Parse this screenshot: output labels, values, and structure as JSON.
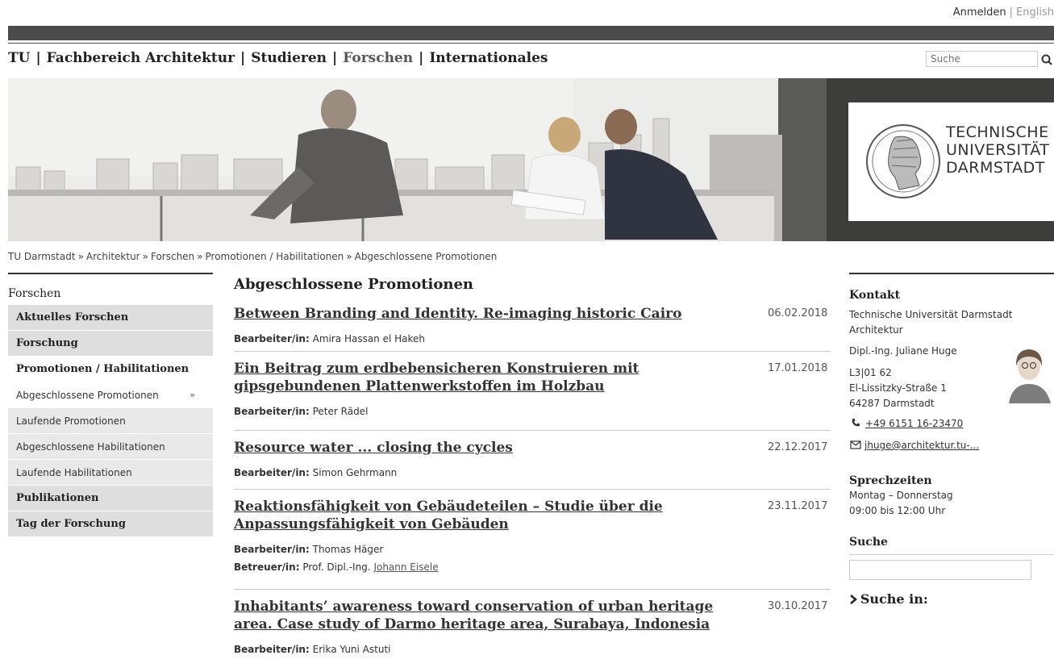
{
  "topmeta": {
    "login": "Anmelden",
    "separator": "|",
    "language": "English"
  },
  "mainnav": {
    "items": [
      "TU",
      "Fachbereich Architektur",
      "Studieren",
      "Forschen",
      "Internationales"
    ],
    "separator": "|"
  },
  "search": {
    "placeholder": "Suche"
  },
  "logo": {
    "line1": "TECHNISCHE",
    "line2": "UNIVERSITÄT",
    "line3": "DARMSTADT"
  },
  "breadcrumb": {
    "items": [
      "TU Darmstadt",
      "Architektur",
      "Forschen",
      "Promotionen / Habilitationen",
      "Abgeschlossene Promotionen"
    ],
    "arrow": "»"
  },
  "leftnav": {
    "heading": "Forschen",
    "items": [
      {
        "label": "Aktuelles Forschen"
      },
      {
        "label": "Forschung"
      },
      {
        "label": "Promotionen / Habilitationen"
      },
      {
        "label": "Abgeschlossene Promotionen",
        "chevron": "»"
      },
      {
        "label": "Laufende Promotionen"
      },
      {
        "label": "Abgeschlossene Habilitationen"
      },
      {
        "label": "Laufende Habilitationen"
      },
      {
        "label": "Publikationen"
      },
      {
        "label": "Tag der Forschung"
      }
    ]
  },
  "main": {
    "heading": "Abgeschlossene Promotionen",
    "entries": [
      {
        "title": "Between Branding and Identity. Re-imaging historic Cairo",
        "date": "06.02.2018",
        "author_label": "Bearbeiter/in:",
        "author": "Amira Hassan el Hakeh"
      },
      {
        "title": "Ein Beitrag zum erdbebensicheren Konstruieren mit gipsgebundenen Plattenwerkstoffen im Holzbau",
        "date": "17.01.2018",
        "author_label": "Bearbeiter/in:",
        "author": "Peter Rädel"
      },
      {
        "title": "Resource water ... closing the cycles",
        "date": "22.12.2017",
        "author_label": "Bearbeiter/in:",
        "author": "Simon Gehrmann"
      },
      {
        "title": "Reaktionsfähigkeit von Gebäudeteilen – Studie über die Anpassungsfähigkeit von Gebäuden",
        "date": "23.11.2017",
        "author_label": "Bearbeiter/in:",
        "author": "Thomas Häger",
        "supervisor_label": "Betreuer/in:",
        "supervisor_prefix": "Prof. Dipl.-Ing.",
        "supervisor": "Johann Eisele"
      },
      {
        "title": "Inhabitants’ awareness toward conservation of urban heritage area. Case study of Darmo heritage area, Surabaya, Indonesia",
        "date": "30.10.2017",
        "author_label": "Bearbeiter/in:",
        "author": "Erika Yuni Astuti"
      }
    ]
  },
  "contact": {
    "heading": "Kontakt",
    "org1": "Technische Universität Darmstadt",
    "org2": "Architektur",
    "name": "Dipl.-Ing. Juliane Huge",
    "room": "L3|01 62",
    "street": "El-Lissitzky-Straße 1",
    "city": "64287 Darmstadt",
    "phone": "+49 6151 16-23470",
    "email": "jhuge@architektur.tu-...",
    "hours_heading": "Sprechzeiten",
    "hours_days": "Montag – Donnerstag",
    "hours_time": "09:00 bis 12:00 Uhr"
  },
  "right_search": {
    "heading": "Suche",
    "search_in": "Suche in:"
  },
  "colors": {
    "dark_bar": "#4b4b4b",
    "nav_bg": "#dedede",
    "nav_bg_light": "#e9e9e9"
  }
}
